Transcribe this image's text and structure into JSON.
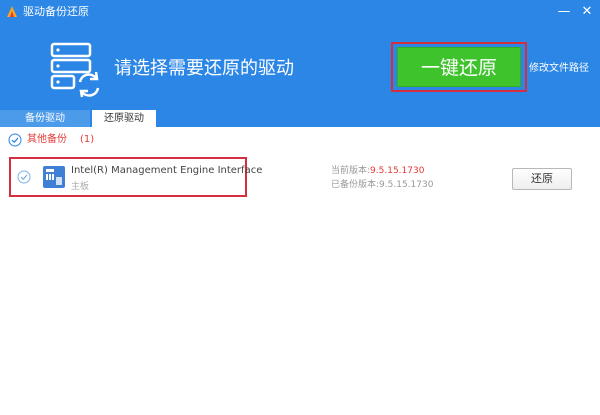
{
  "window": {
    "title": "驱动备份还原",
    "minimize_glyph": "—",
    "close_glyph": "✕"
  },
  "header": {
    "headline": "请选择需要还原的驱动",
    "restore_all_label": "一键还原",
    "modify_path_label": "修改文件路径"
  },
  "tabs": [
    {
      "label": "备份驱动",
      "active": false
    },
    {
      "label": "还原驱动",
      "active": true
    }
  ],
  "group": {
    "label": "其他备份",
    "count": "(1)"
  },
  "drivers": [
    {
      "name": "Intel(R) Management Engine Interface",
      "category": "主板",
      "current_version_label": "当前版本:",
      "current_version": "9.5.15.1730",
      "backup_version_label": "已备份版本:",
      "backup_version": "9.5.15.1730",
      "restore_label": "还原"
    }
  ],
  "colors": {
    "header_blue": "#2b86e5",
    "restore_green": "#3fc32d",
    "highlight_red": "#d32f3f",
    "group_red": "#e53935"
  },
  "icons": [
    "app-logo-icon",
    "server-sync-icon",
    "check-circle-icon",
    "chip-icon"
  ]
}
